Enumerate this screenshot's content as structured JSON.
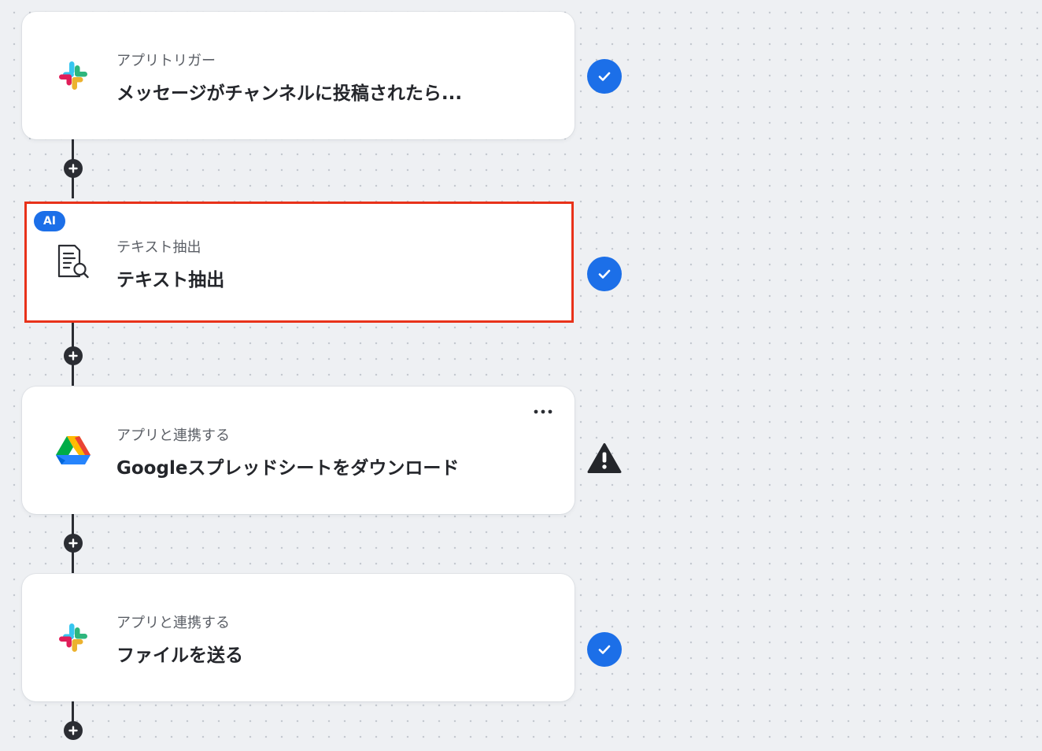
{
  "colors": {
    "accent": "#1c6fe8",
    "selection": "#e8321a",
    "connector": "#2b2d33",
    "warning": "#24262b"
  },
  "flow": {
    "steps": [
      {
        "subtitle": "アプリトリガー",
        "title": "メッセージがチャンネルに投稿されたら...",
        "icon": "slack-icon",
        "status": "complete",
        "status_icon": "check-icon"
      },
      {
        "badge": "AI",
        "subtitle": "テキスト抽出",
        "title": "テキスト抽出",
        "icon": "document-search-icon",
        "status": "complete",
        "status_icon": "check-icon",
        "selected": true
      },
      {
        "subtitle": "アプリと連携する",
        "title": "Googleスプレッドシートをダウンロード",
        "icon": "google-drive-icon",
        "status": "warning",
        "status_icon": "warning-icon",
        "menu_icon": "more-horizontal-icon"
      },
      {
        "subtitle": "アプリと連携する",
        "title": "ファイルを送る",
        "icon": "slack-icon",
        "status": "complete",
        "status_icon": "check-icon"
      }
    ],
    "add_icon": "plus-icon"
  }
}
